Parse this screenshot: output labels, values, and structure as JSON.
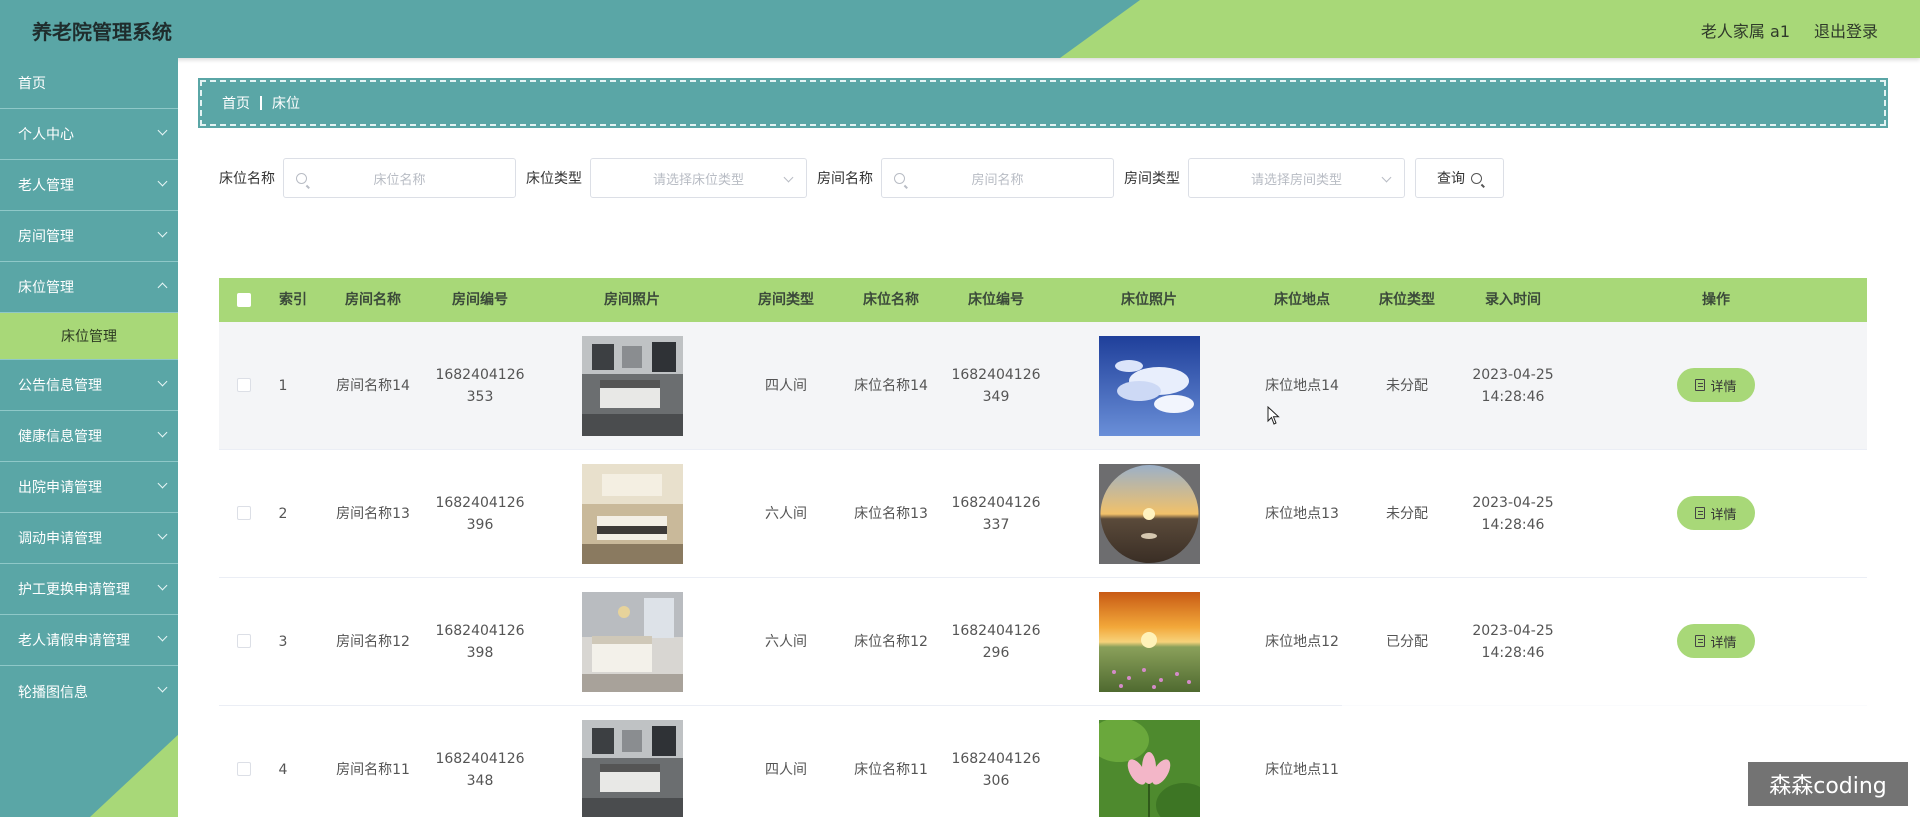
{
  "header": {
    "title": "养老院管理系统",
    "user": "老人家属 a1",
    "logout": "退出登录"
  },
  "sidebar": {
    "items": [
      {
        "label": "首页",
        "expandable": false
      },
      {
        "label": "个人中心",
        "expandable": true
      },
      {
        "label": "老人管理",
        "expandable": true
      },
      {
        "label": "房间管理",
        "expandable": true
      },
      {
        "label": "床位管理",
        "expandable": true
      },
      {
        "label": "公告信息管理",
        "expandable": true
      },
      {
        "label": "健康信息管理",
        "expandable": true
      },
      {
        "label": "出院申请管理",
        "expandable": true
      },
      {
        "label": "调动申请管理",
        "expandable": true
      },
      {
        "label": "护工更换申请管理",
        "expandable": true
      },
      {
        "label": "老人请假申请管理",
        "expandable": true
      },
      {
        "label": "轮播图信息",
        "expandable": true
      }
    ],
    "active_sub": "床位管理"
  },
  "breadcrumb": {
    "home": "首页",
    "current": "床位"
  },
  "search": {
    "bed_name_label": "床位名称",
    "bed_name_placeholder": "床位名称",
    "bed_type_label": "床位类型",
    "bed_type_placeholder": "请选择床位类型",
    "room_name_label": "房间名称",
    "room_name_placeholder": "房间名称",
    "room_type_label": "房间类型",
    "room_type_placeholder": "请选择房间类型",
    "query_button": "查询"
  },
  "table": {
    "columns": [
      "索引",
      "房间名称",
      "房间编号",
      "房间照片",
      "房间类型",
      "床位名称",
      "床位编号",
      "床位照片",
      "床位地点",
      "床位类型",
      "录入时间",
      "操作"
    ],
    "rows": [
      {
        "index": "1",
        "room_name": "房间名称14",
        "room_no_1": "1682404126",
        "room_no_2": "353",
        "room_type": "四人间",
        "bed_name": "床位名称14",
        "bed_no_1": "1682404126",
        "bed_no_2": "349",
        "location": "床位地点14",
        "bed_type": "未分配",
        "time_1": "2023-04-25",
        "time_2": "14:28:46",
        "action": "详情",
        "room_photo": "bedroom-gray",
        "bed_photo": "sky-clouds"
      },
      {
        "index": "2",
        "room_name": "房间名称13",
        "room_no_1": "1682404126",
        "room_no_2": "396",
        "room_type": "六人间",
        "bed_name": "床位名称13",
        "bed_no_1": "1682404126",
        "bed_no_2": "337",
        "location": "床位地点13",
        "bed_type": "未分配",
        "time_1": "2023-04-25",
        "time_2": "14:28:46",
        "action": "详情",
        "room_photo": "bedroom-beige",
        "bed_photo": "sunset-fisheye"
      },
      {
        "index": "3",
        "room_name": "房间名称12",
        "room_no_1": "1682404126",
        "room_no_2": "398",
        "room_type": "六人间",
        "bed_name": "床位名称12",
        "bed_no_1": "1682404126",
        "bed_no_2": "296",
        "location": "床位地点12",
        "bed_type": "已分配",
        "time_1": "2023-04-25",
        "time_2": "14:28:46",
        "action": "详情",
        "room_photo": "bedroom-white",
        "bed_photo": "sunset-field"
      },
      {
        "index": "4",
        "room_name": "房间名称11",
        "room_no_1": "1682404126",
        "room_no_2": "348",
        "room_type": "四人间",
        "bed_name": "床位名称11",
        "bed_no_1": "1682404126",
        "bed_no_2": "306",
        "location": "床位地点11",
        "bed_type": "",
        "time_1": "",
        "time_2": "",
        "action": "",
        "room_photo": "bedroom-gray",
        "bed_photo": "lotus-flower"
      }
    ]
  },
  "watermark": "森森coding",
  "colors": {
    "teal": "#5aa6a6",
    "green": "#a8d878"
  }
}
